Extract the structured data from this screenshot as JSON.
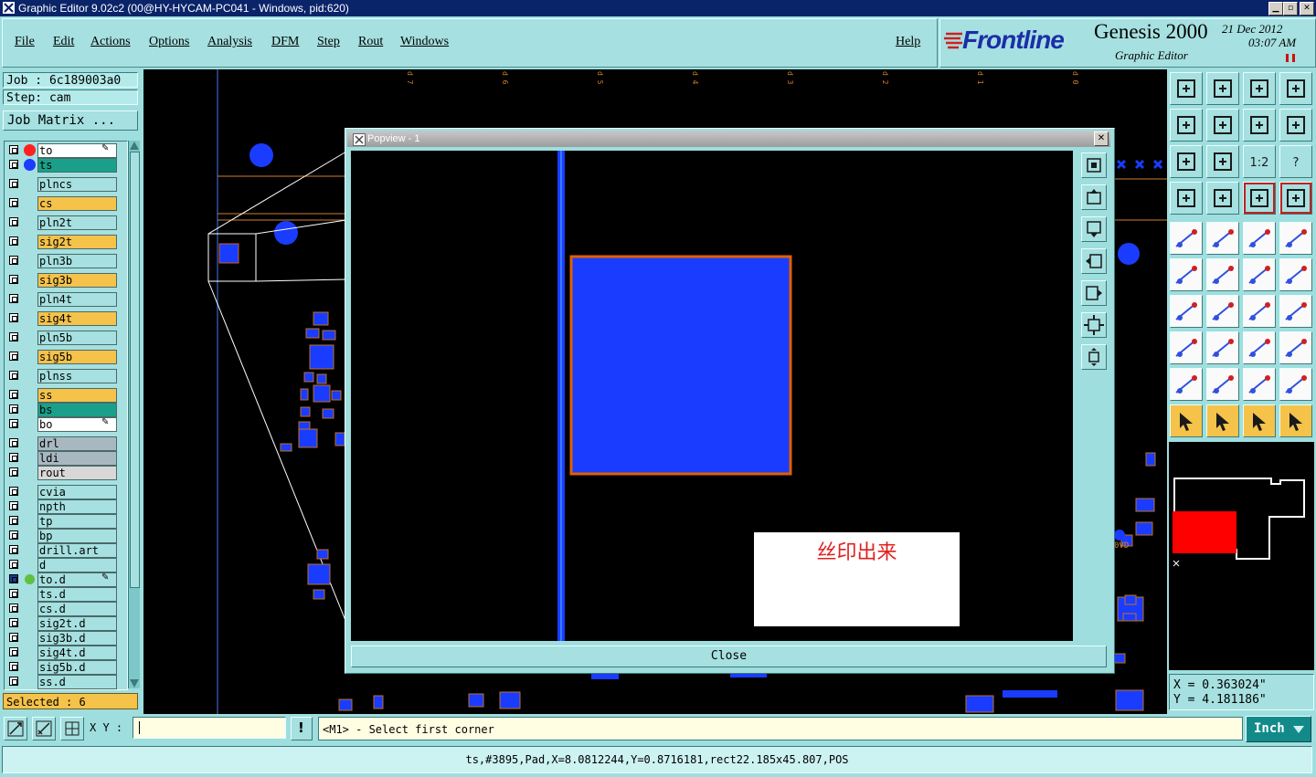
{
  "window": {
    "title": "Graphic Editor 9.02c2 (00@HY-HYCAM-PC041 - Windows, pid:620)",
    "buttons": [
      "minimize",
      "maximize",
      "close"
    ]
  },
  "menu": {
    "items": [
      "File",
      "Edit",
      "Actions",
      "Options",
      "Analysis",
      "DFM",
      "Step",
      "Rout",
      "Windows"
    ],
    "help": "Help"
  },
  "brand": {
    "company": "Frontline",
    "product": "Genesis 2000",
    "subtitle": "Graphic Editor",
    "date": "21 Dec 2012",
    "time": "03:07 AM"
  },
  "job": {
    "job_label": "Job : 6c189003a0",
    "step_label": "Step: cam",
    "matrix_button": "Job Matrix ..."
  },
  "layers": [
    {
      "name": "to",
      "color": "#ffffff",
      "dot": "#ff2020",
      "mark": "✎"
    },
    {
      "name": "ts",
      "color": "#1aa08a",
      "dot": "#1a3cff"
    },
    {
      "name": "plncs",
      "color": "#a6e0e0"
    },
    {
      "name": "cs",
      "color": "#f5c24a"
    },
    {
      "name": "pln2t",
      "color": "#a6e0e0"
    },
    {
      "name": "sig2t",
      "color": "#f5c24a"
    },
    {
      "name": "pln3b",
      "color": "#a6e0e0"
    },
    {
      "name": "sig3b",
      "color": "#f5c24a"
    },
    {
      "name": "pln4t",
      "color": "#a6e0e0"
    },
    {
      "name": "sig4t",
      "color": "#f5c24a"
    },
    {
      "name": "pln5b",
      "color": "#a6e0e0"
    },
    {
      "name": "sig5b",
      "color": "#f5c24a"
    },
    {
      "name": "plnss",
      "color": "#a6e0e0"
    },
    {
      "name": "ss",
      "color": "#f5c24a"
    },
    {
      "name": "bs",
      "color": "#1aa08a"
    },
    {
      "name": "bo",
      "color": "#ffffff",
      "mark": "✎"
    },
    {
      "name": "drl",
      "color": "#a8b8c0"
    },
    {
      "name": "ldi",
      "color": "#a8b8c0"
    },
    {
      "name": "rout",
      "color": "#d8d8d8"
    },
    {
      "name": "cvia",
      "color": "#a6e0e0"
    },
    {
      "name": "npth",
      "color": "#a6e0e0"
    },
    {
      "name": "tp",
      "color": "#a6e0e0"
    },
    {
      "name": "bp",
      "color": "#a6e0e0"
    },
    {
      "name": "drill.art",
      "color": "#a6e0e0"
    },
    {
      "name": "d",
      "color": "#a6e0e0"
    },
    {
      "name": "to.d",
      "color": "#a6e0e0",
      "mark": "✎",
      "active": true
    },
    {
      "name": "ts.d",
      "color": "#a6e0e0"
    },
    {
      "name": "cs.d",
      "color": "#a6e0e0"
    },
    {
      "name": "sig2t.d",
      "color": "#a6e0e0"
    },
    {
      "name": "sig3b.d",
      "color": "#a6e0e0"
    },
    {
      "name": "sig4t.d",
      "color": "#a6e0e0"
    },
    {
      "name": "sig5b.d",
      "color": "#a6e0e0"
    },
    {
      "name": "ss.d",
      "color": "#a6e0e0"
    }
  ],
  "selected": "Selected : 6",
  "canvas": {
    "column_labels": [
      "d 7",
      "d 6",
      "d 5",
      "d 4",
      "d 3",
      "d 2",
      "d 1",
      "d 0"
    ],
    "labels": [
      "0VD"
    ]
  },
  "popview": {
    "title": "Popview - 1",
    "note": "丝印出来",
    "close_label": "Close"
  },
  "tools": {
    "fit_label": "1:2"
  },
  "coords": {
    "x": "X = 0.363024\"",
    "y": "Y = 4.181186\""
  },
  "input": {
    "xy_label": "X Y :",
    "xy_value": "",
    "exclaim": "!",
    "prompt": "<M1> - Select first corner",
    "unit": "Inch"
  },
  "status": "ts,#3895,Pad,X=8.0812244,Y=0.8716181,rect22.185x45.807,POS",
  "colors": {
    "accent": "#1a3cff",
    "outline": "#e06000",
    "panel": "#a6e0e0",
    "highlight": "#f5c24a"
  }
}
